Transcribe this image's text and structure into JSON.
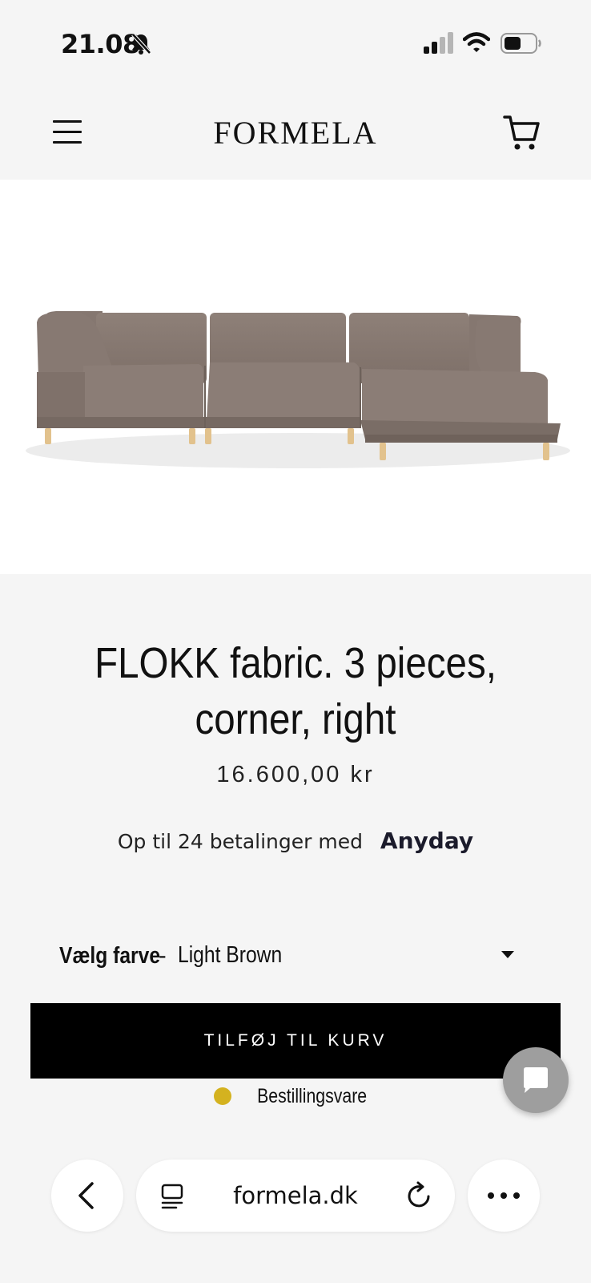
{
  "status_bar": {
    "time": "21.08",
    "icons": [
      "bell-muted-icon",
      "signal-icon",
      "wifi-icon",
      "battery-icon"
    ]
  },
  "header": {
    "logo": "FORMELA",
    "icons": [
      "hamburger-menu-icon",
      "cart-icon"
    ]
  },
  "product": {
    "title": "FLOKK fabric. 3 pieces, corner, right",
    "price": "16.600,00 kr",
    "installments_text": "Op til 24 betalinger med",
    "installments_provider": "Anyday",
    "color_label": "Vælg farve",
    "color_separator": "-",
    "color_value": "Light Brown",
    "add_to_cart": "TILFØJ TIL KURV",
    "stock_status": "Bestillingsvare",
    "stock_color": "#d4b21f"
  },
  "chat": {
    "icon": "chat-bubble-icon"
  },
  "browser": {
    "url": "formela.dk",
    "icons": [
      "back-chevron-icon",
      "reader-icon",
      "reload-icon",
      "more-icon"
    ]
  },
  "colors": {
    "sofa": "#8a7b73",
    "button": "#000000",
    "page_bg": "#f5f5f5"
  }
}
